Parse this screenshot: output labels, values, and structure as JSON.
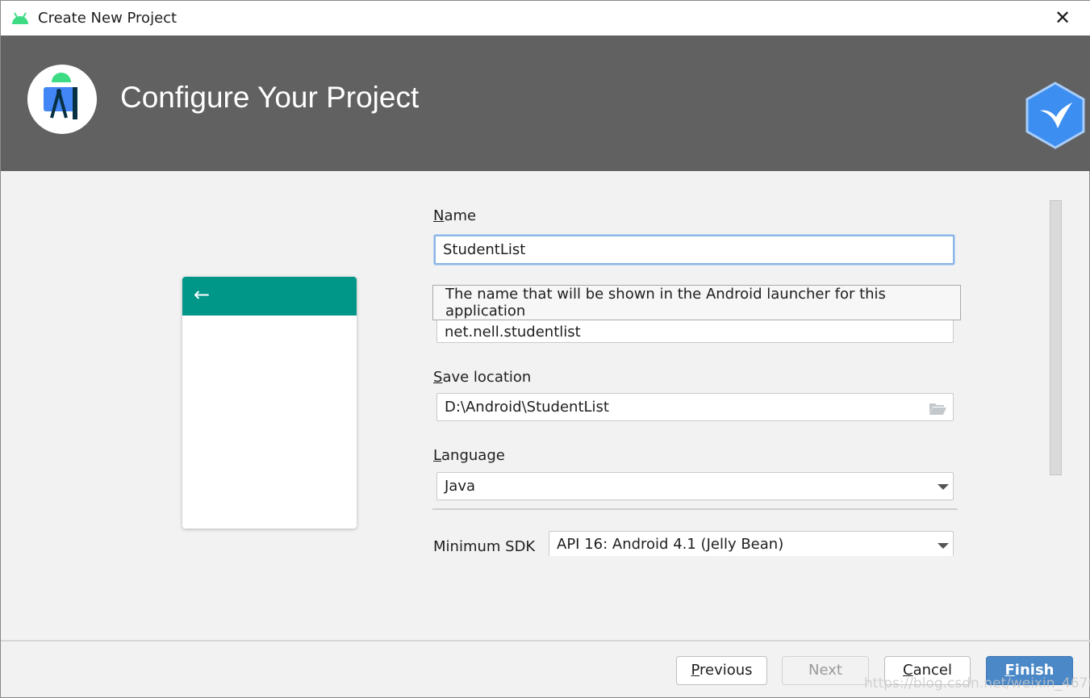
{
  "window": {
    "title": "Create New Project",
    "close_icon": "close-icon",
    "app_icon": "android-icon"
  },
  "header": {
    "title": "Configure Your Project",
    "logo": "android-studio-logo",
    "brand_icon": "bird-hexagon-icon"
  },
  "preview": {
    "back_icon": "arrow-left-icon",
    "accent": "#009688"
  },
  "form": {
    "name": {
      "label_u": "N",
      "label_rest": "ame",
      "value": "StudentList"
    },
    "tooltip": "The name that will be shown in the Android launcher for this application",
    "package": {
      "value": "net.nell.studentlist"
    },
    "save_location": {
      "label_u": "S",
      "label_rest": "ave location",
      "value": "D:\\Android\\StudentList",
      "icon": "folder-open-icon"
    },
    "language": {
      "label_u": "L",
      "label_rest": "anguage",
      "value": "Java"
    },
    "min_sdk": {
      "label": "Minimum SDK",
      "value": "API 16: Android 4.1 (Jelly Bean)"
    }
  },
  "footer": {
    "previous_u": "P",
    "previous_rest": "revious",
    "next": "Next",
    "cancel_u": "C",
    "cancel_rest": "ancel",
    "finish_u": "F",
    "finish_rest": "inish",
    "finish_color": "#4a88c7"
  },
  "watermark": "https://blog.csdn.net/weixin_46705517"
}
